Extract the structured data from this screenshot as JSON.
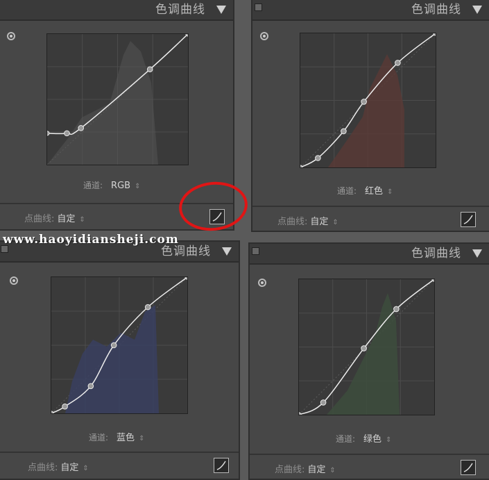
{
  "panel_title": "色调曲线",
  "channel_label": "通道:",
  "point_curve_label": "点曲线:",
  "point_curve_value": "自定",
  "watermark": "www.haoyidiansheji.com",
  "colors": {
    "accent_annotation": "#e01515",
    "curve": "#eeeeee",
    "rgb_hist": "#555555",
    "red_hist": "#5a3a36",
    "blue_hist": "#3a4060",
    "green_hist": "#3d4d3d"
  },
  "panels": [
    {
      "channel": "RGB",
      "curve_points": [
        [
          0,
          0.24
        ],
        [
          0.14,
          0.24
        ],
        [
          0.24,
          0.28
        ],
        [
          0.73,
          0.73
        ],
        [
          1,
          1
        ]
      ]
    },
    {
      "channel": "红色",
      "curve_points": [
        [
          0,
          0
        ],
        [
          0.13,
          0.07
        ],
        [
          0.32,
          0.27
        ],
        [
          0.47,
          0.49
        ],
        [
          0.72,
          0.78
        ],
        [
          1,
          1
        ]
      ]
    },
    {
      "channel": "蓝色",
      "curve_points": [
        [
          0,
          0
        ],
        [
          0.1,
          0.05
        ],
        [
          0.29,
          0.2
        ],
        [
          0.46,
          0.5
        ],
        [
          0.71,
          0.78
        ],
        [
          1,
          1
        ]
      ]
    },
    {
      "channel": "绿色",
      "curve_points": [
        [
          0,
          0
        ],
        [
          0.18,
          0.09
        ],
        [
          0.48,
          0.49
        ],
        [
          0.72,
          0.78
        ],
        [
          1,
          1
        ]
      ]
    }
  ]
}
